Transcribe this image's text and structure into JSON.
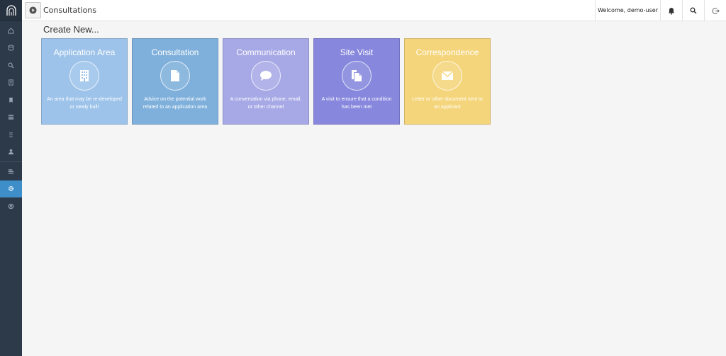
{
  "header": {
    "title": "Consultations",
    "welcome": "Welcome, demo-user"
  },
  "main": {
    "heading": "Create New...",
    "cards": [
      {
        "title": "Application Area",
        "description": "An area that may be re-developed or newly built",
        "icon": "building-icon",
        "color": "#9dc3ea"
      },
      {
        "title": "Consultation",
        "description": "Advice on the potential work related to an application area",
        "icon": "document-icon",
        "color": "#7fb0db"
      },
      {
        "title": "Communication",
        "description": "A conversation via phone, email, or other channel",
        "icon": "chat-bubble-icon",
        "color": "#a7a9e6"
      },
      {
        "title": "Site Visit",
        "description": "A visit to ensure that a condition has been met",
        "icon": "copy-files-icon",
        "color": "#8687dd"
      },
      {
        "title": "Correspondence",
        "description": "Letter or other document sent to an applicant",
        "icon": "envelope-icon",
        "color": "#f5d57b"
      }
    ]
  },
  "sidebar": {
    "items": [
      {
        "icon": "home-icon",
        "active": false
      },
      {
        "icon": "database-icon",
        "active": false
      },
      {
        "icon": "search-icon",
        "active": false
      },
      {
        "icon": "report-icon",
        "active": false
      },
      {
        "icon": "bookmark-icon",
        "active": false
      },
      {
        "icon": "list-icon",
        "active": false
      },
      {
        "icon": "dots-grid-icon",
        "active": false
      },
      {
        "icon": "user-icon",
        "active": false
      },
      {
        "icon": "collection-icon",
        "active": false
      },
      {
        "icon": "settings-gear-icon",
        "active": true
      },
      {
        "icon": "help-circle-icon",
        "active": false
      }
    ]
  },
  "colors": {
    "sidebar": "#2c3a4a",
    "active_accent": "#3d8ec9"
  }
}
